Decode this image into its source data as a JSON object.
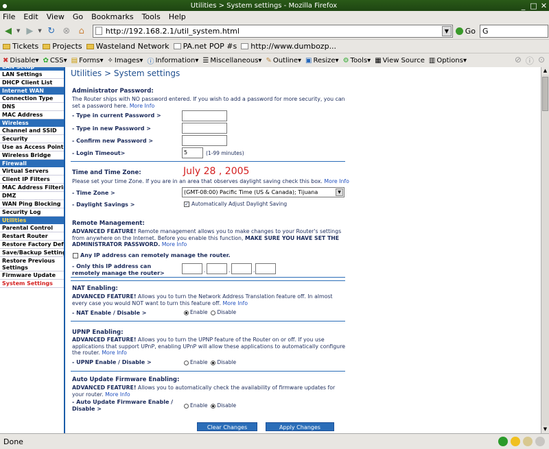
{
  "window": {
    "title": "Utilities > System settings - Mozilla Firefox"
  },
  "menu": [
    "File",
    "Edit",
    "View",
    "Go",
    "Bookmarks",
    "Tools",
    "Help"
  ],
  "nav": {
    "url": "http://192.168.2.1/util_system.html",
    "go_label": "Go",
    "search_value": ""
  },
  "bookmarks": [
    {
      "label": "Tickets",
      "type": "folder"
    },
    {
      "label": "Projects",
      "type": "folder"
    },
    {
      "label": "Wasteland Network",
      "type": "folder"
    },
    {
      "label": "PA.net POP #s",
      "type": "page"
    },
    {
      "label": "http://www.dumbozp...",
      "type": "page"
    }
  ],
  "devbar": [
    "Disable▾",
    "CSS▾",
    "Forms▾",
    "Images▾",
    "Information▾",
    "Miscellaneous▾",
    "Outline▾",
    "Resize▾",
    "Tools▾",
    "View Source",
    "Options▾"
  ],
  "sidebar": {
    "lan_head": "LAN Setup",
    "lan": [
      "LAN Settings",
      "DHCP Client List"
    ],
    "wan_head": "Internet WAN",
    "wan": [
      "Connection Type",
      "DNS",
      "MAC Address"
    ],
    "wireless_head": "Wireless",
    "wireless": [
      "Channel and SSID",
      "Security",
      "Use as Access Point",
      "Wireless Bridge"
    ],
    "firewall_head": "Firewall",
    "firewall": [
      "Virtual Servers",
      "Client IP Filters",
      "MAC Address Filtering",
      "DMZ",
      "WAN Ping Blocking",
      "Security Log"
    ],
    "utilities_head": "Utilities",
    "utilities": [
      "Parental Control",
      "Restart Router",
      "Restore Factory Default",
      "Save/Backup Settings",
      "Restore Previous Settings",
      "Firmware Update",
      "System Settings"
    ]
  },
  "page": {
    "breadcrumb": "Utilities > System settings",
    "admin": {
      "title": "Administrator Password:",
      "desc": "The Router ships with NO password entered. If you wish to add a password for more security, you can set a password here.",
      "more": "More Info",
      "current_label": "- Type in current Password >",
      "new_label": "- Type in new Password >",
      "confirm_label": "- Confirm new Password >",
      "timeout_label": "- Login Timeout>",
      "timeout_value": "5",
      "timeout_hint": "(1-99 minutes)"
    },
    "time": {
      "title": "Time and Time Zone:",
      "date": "July 28 , 2005",
      "desc": "Please set your time Zone. If you are in an area that observes daylight saving check this box.",
      "more": "More Info",
      "zone_label": "- Time Zone >",
      "zone_value": "(GMT-08:00) Pacific Time (US & Canada); Tijuana",
      "dst_label": "- Daylight Savings >",
      "dst_option": "Automatically Adjust Daylight Saving"
    },
    "remote": {
      "title": "Remote Management:",
      "adv": "ADVANCED FEATURE!",
      "desc": " Remote management allows you to make changes to your Router's settings from anywhere on the Internet. Before you enable this function, ",
      "warn": "MAKE SURE YOU HAVE SET THE ADMINISTRATOR PASSWORD.",
      "more": "More Info",
      "any_ip": "Any IP address can remotely manage the router.",
      "only_ip_label": "- Only this IP address can remotely manage the router>"
    },
    "nat": {
      "title": "NAT Enabling:",
      "adv": "ADVANCED FEATURE!",
      "desc": " Allows you to turn the Network Address Translation feature off. In almost every case you would NOT want to turn this feature off.",
      "more": "More Info",
      "label": "- NAT Enable / Disable >",
      "enable": "Enable",
      "disable": "Disable"
    },
    "upnp": {
      "title": "UPNP Enabling:",
      "adv": "ADVANCED FEATURE!",
      "desc": " Allows you to turn the UPNP feature of the Router on or off. If you use applications that support UPnP, enabling UPnP will allow these applications to automatically configure the router.",
      "more": "More Info",
      "label": "- UPNP Enable / Disable >",
      "enable": "Enable",
      "disable": "Disable"
    },
    "auto": {
      "title": "Auto Update Firmware Enabling:",
      "adv": "ADVANCED FEATURE!",
      "desc": " Allows you to automatically check the availability of firmware updates for your router.",
      "more": "More Info",
      "label": "- Auto Update Firmware Enable / Disable >",
      "enable": "Enable",
      "disable": "Disable"
    },
    "buttons": {
      "clear": "Clear Changes",
      "apply": "Apply Changes"
    }
  },
  "status": {
    "text": "Done"
  }
}
